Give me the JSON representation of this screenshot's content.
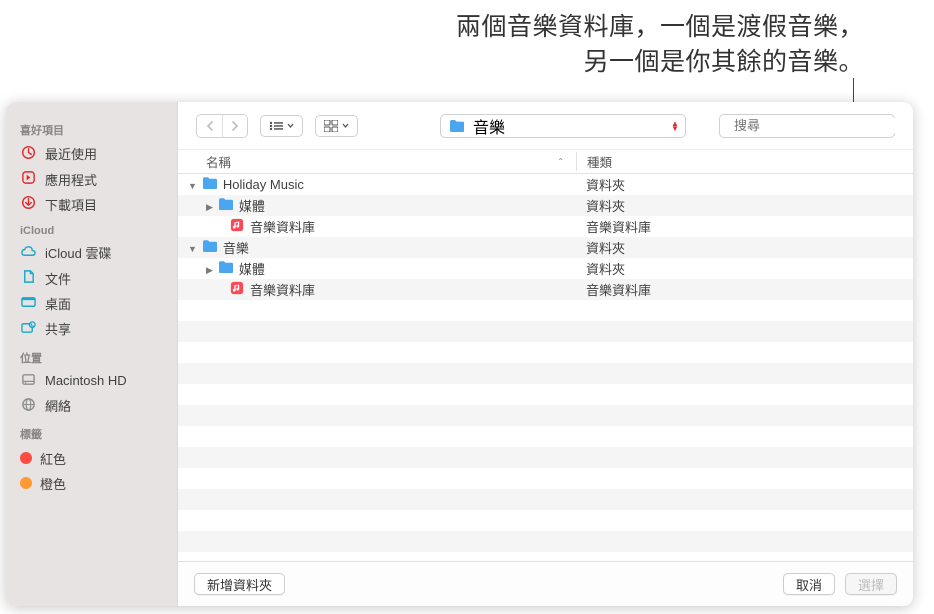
{
  "annotation": {
    "line1": "兩個音樂資料庫，一個是渡假音樂，",
    "line2": "另一個是你其餘的音樂。"
  },
  "sidebar": {
    "sections": [
      {
        "label": "喜好項目",
        "items": [
          {
            "icon": "clock",
            "label": "最近使用",
            "color": "#e12a2a"
          },
          {
            "icon": "app",
            "label": "應用程式",
            "color": "#e12a2a"
          },
          {
            "icon": "download",
            "label": "下載項目",
            "color": "#e12a2a"
          }
        ]
      },
      {
        "label": "iCloud",
        "items": [
          {
            "icon": "cloud",
            "label": "iCloud 雲碟",
            "color": "#17a9c9"
          },
          {
            "icon": "doc",
            "label": "文件",
            "color": "#17a9c9"
          },
          {
            "icon": "desktop",
            "label": "桌面",
            "color": "#17a9c9"
          },
          {
            "icon": "share",
            "label": "共享",
            "color": "#17a9c9"
          }
        ]
      },
      {
        "label": "位置",
        "items": [
          {
            "icon": "hdd",
            "label": "Macintosh HD",
            "color": "#8d8d8d"
          },
          {
            "icon": "globe",
            "label": "網絡",
            "color": "#8d8d8d"
          }
        ]
      },
      {
        "label": "標籤",
        "items": [
          {
            "icon": "tag",
            "label": "紅色",
            "color": "#ff4b42"
          },
          {
            "icon": "tag",
            "label": "橙色",
            "color": "#ff9a33"
          }
        ]
      }
    ]
  },
  "toolbar": {
    "current_folder": "音樂",
    "search_placeholder": "搜尋"
  },
  "columns": {
    "name": "名稱",
    "type": "種類"
  },
  "rows": [
    {
      "indent": 0,
      "disclosure": "down",
      "icon": "folder",
      "name": "Holiday Music",
      "type": "資料夾",
      "alt": false
    },
    {
      "indent": 1,
      "disclosure": "right",
      "icon": "folder",
      "name": "媒體",
      "type": "資料夾",
      "alt": true
    },
    {
      "indent": 2,
      "disclosure": "",
      "icon": "library",
      "name": "音樂資料庫",
      "type": "音樂資料庫",
      "alt": false
    },
    {
      "indent": 0,
      "disclosure": "down",
      "icon": "folder",
      "name": "音樂",
      "type": "資料夾",
      "alt": true
    },
    {
      "indent": 1,
      "disclosure": "right",
      "icon": "folder",
      "name": "媒體",
      "type": "資料夾",
      "alt": false
    },
    {
      "indent": 2,
      "disclosure": "",
      "icon": "library",
      "name": "音樂資料庫",
      "type": "音樂資料庫",
      "alt": true
    }
  ],
  "footer": {
    "new_folder": "新增資料夾",
    "cancel": "取消",
    "choose": "選擇"
  }
}
